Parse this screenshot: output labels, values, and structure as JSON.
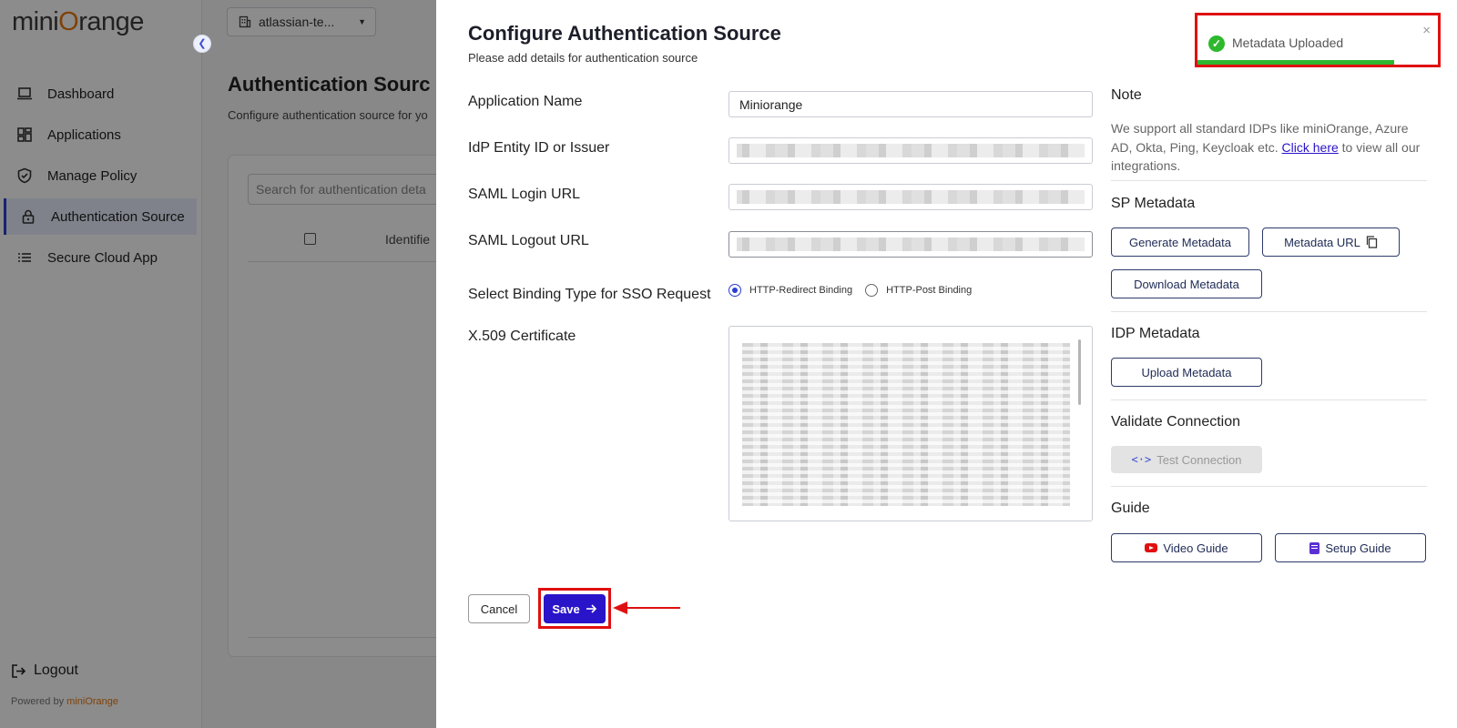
{
  "brand": {
    "logo_pre": "mini",
    "logo_o": "O",
    "logo_post": "range",
    "powered_by_prefix": "Powered by ",
    "powered_by_brand": "miniOrange"
  },
  "sidebar": {
    "items": [
      {
        "label": "Dashboard",
        "icon": "laptop-icon",
        "active": false
      },
      {
        "label": "Applications",
        "icon": "grid-icon",
        "active": false
      },
      {
        "label": "Manage Policy",
        "icon": "shield-icon",
        "active": false
      },
      {
        "label": "Authentication Source",
        "icon": "lock-icon",
        "active": true
      },
      {
        "label": "Secure Cloud App",
        "icon": "list-icon",
        "active": false
      }
    ],
    "logout": "Logout"
  },
  "background": {
    "tenant": "atlassian-te...",
    "title": "Authentication Sourc",
    "subtitle": "Configure authentication source for yo",
    "search_placeholder": "Search for authentication deta",
    "column_header": "Identifie"
  },
  "drawer": {
    "title": "Configure Authentication Source",
    "subtitle": "Please add details for authentication source",
    "fields": {
      "app_name": {
        "label": "Application Name",
        "value": "Miniorange"
      },
      "entity_id": {
        "label": "IdP Entity ID or Issuer"
      },
      "login_url": {
        "label": "SAML Login URL"
      },
      "logout_url": {
        "label": "SAML Logout URL"
      },
      "binding": {
        "label": "Select Binding Type for SSO Request",
        "option1": "HTTP-Redirect Binding",
        "option2": "HTTP-Post Binding",
        "selected": "HTTP-Redirect Binding"
      },
      "certificate": {
        "label": "X.509 Certificate"
      }
    },
    "cancel": "Cancel",
    "save": "Save"
  },
  "right_panel": {
    "note_heading": "Note",
    "note_text": "We support all standard IDPs like  miniOrange, Azure AD, Okta, Ping, Keycloak etc.",
    "note_link": "Click here",
    "note_suffix": " to view all our integrations.",
    "sp_heading": "SP Metadata",
    "generate_metadata": "Generate Metadata",
    "metadata_url": "Metadata URL",
    "download_metadata": "Download Metadata",
    "idp_heading": "IDP Metadata",
    "upload_metadata": "Upload Metadata",
    "validate_heading": "Validate Connection",
    "test_connection": "Test Connection",
    "guide_heading": "Guide",
    "video_guide": "Video Guide",
    "setup_guide": "Setup Guide"
  },
  "toast": {
    "message": "Metadata Uploaded",
    "close": "×",
    "progress": 0.82
  },
  "colors": {
    "accent": "#2a14c9",
    "highlight": "#e01010",
    "success": "#2eb82e",
    "brand_orange": "#e8780e"
  }
}
